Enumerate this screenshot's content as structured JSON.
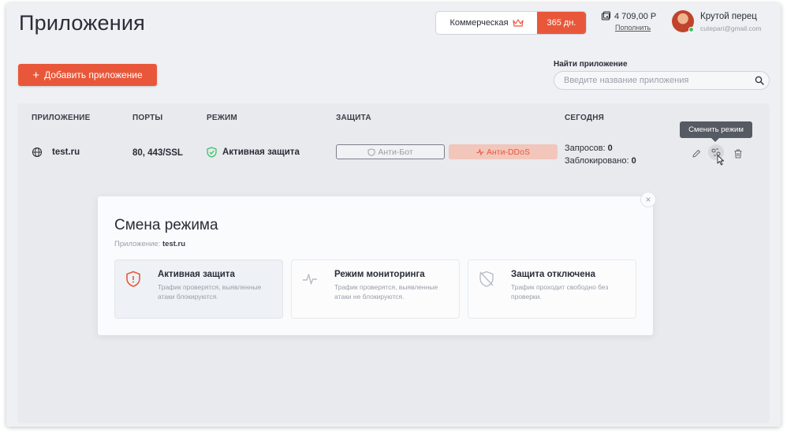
{
  "page": {
    "title": "Приложения"
  },
  "header": {
    "plan_name": "Коммерческая",
    "plan_days": "365 дн.",
    "balance": "4 709,00 Р",
    "topup": "Пополнить",
    "user_name": "Крутой перец",
    "user_email": "cutepari@gmail.com"
  },
  "toolbar": {
    "add_button": "Добавить приложение",
    "search_label": "Найти приложение",
    "search_placeholder": "Введите название приложения"
  },
  "table": {
    "headers": [
      "ПРИЛОЖЕНИЕ",
      "ПОРТЫ",
      "РЕЖИМ",
      "ЗАЩИТА",
      "СЕГОДНЯ"
    ],
    "rows": [
      {
        "app": "test.ru",
        "ports": "80, 443/SSL",
        "mode": "Активная защита",
        "anti_bot": "Анти-Бот",
        "anti_ddos": "Анти-DDoS",
        "requests_label": "Запросов:",
        "requests_value": "0",
        "blocked_label": "Заблокировано:",
        "blocked_value": "0"
      }
    ],
    "tooltip": "Сменить режим"
  },
  "modal": {
    "title": "Смена режима",
    "app_label": "Приложение:",
    "app_value": "test.ru",
    "close": "×",
    "options": [
      {
        "title": "Активная защита",
        "desc": "Трафик проверятся, выявленные атаки блокируются.",
        "icon": "shield-icon",
        "selected": true
      },
      {
        "title": "Режим мониторинга",
        "desc": "Трафик проверятся, выявленные атаки не блокируются.",
        "icon": "pulse-icon",
        "selected": false
      },
      {
        "title": "Защита отключена",
        "desc": "Трафик проходит свободно без проверки.",
        "icon": "shield-off-icon",
        "selected": false
      }
    ]
  },
  "colors": {
    "accent": "#e9573a",
    "accent_light": "#f2c6bb",
    "success": "#3cc26a",
    "background": "#eef0f3"
  }
}
